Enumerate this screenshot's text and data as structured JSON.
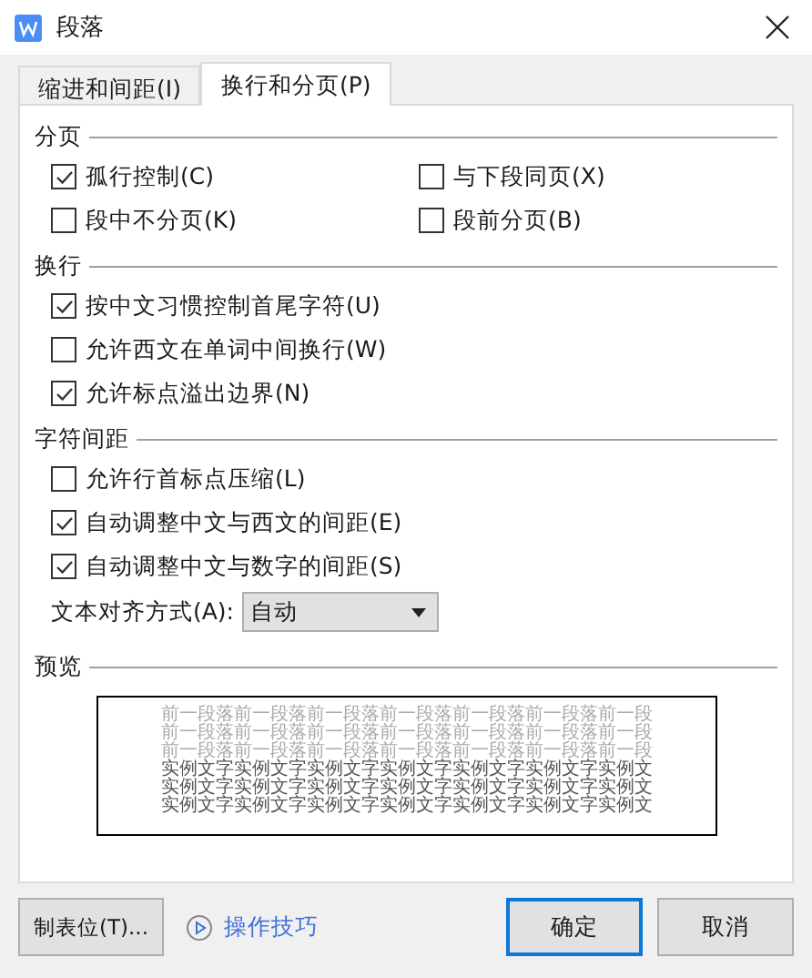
{
  "window": {
    "title": "段落"
  },
  "tabs": [
    {
      "label": "缩进和间距(I)",
      "selected": false
    },
    {
      "label": "换行和分页(P)",
      "selected": true
    }
  ],
  "sections": [
    {
      "title": "分页",
      "kind": "grid",
      "options": [
        {
          "label": "孤行控制(C)",
          "checked": true
        },
        {
          "label": "与下段同页(X)",
          "checked": false
        },
        {
          "label": "段中不分页(K)",
          "checked": false
        },
        {
          "label": "段前分页(B)",
          "checked": false
        }
      ]
    },
    {
      "title": "换行",
      "kind": "list",
      "options": [
        {
          "label": "按中文习惯控制首尾字符(U)",
          "checked": true
        },
        {
          "label": "允许西文在单词中间换行(W)",
          "checked": false
        },
        {
          "label": "允许标点溢出边界(N)",
          "checked": true
        }
      ]
    },
    {
      "title": "字符间距",
      "kind": "list",
      "options": [
        {
          "label": "允许行首标点压缩(L)",
          "checked": false
        },
        {
          "label": "自动调整中文与西文的间距(E)",
          "checked": true
        },
        {
          "label": "自动调整中文与数字的间距(S)",
          "checked": true
        }
      ],
      "select": {
        "label": "文本对齐方式(A):",
        "value": "自动"
      }
    }
  ],
  "preview": {
    "title": "预览",
    "lines": [
      {
        "kind": "previous",
        "text": "前一段落前一段落前一段落前一段落前一段落前一段落前一段"
      },
      {
        "kind": "previous",
        "text": "前一段落前一段落前一段落前一段落前一段落前一段落前一段"
      },
      {
        "kind": "previous",
        "text": "前一段落前一段落前一段落前一段落前一段落前一段落前一段"
      },
      {
        "kind": "sample",
        "text": "实例文字实例文字实例文字实例文字实例文字实例文字实例文"
      },
      {
        "kind": "sample",
        "text": "实例文字实例文字实例文字实例文字实例文字实例文字实例文"
      },
      {
        "kind": "sample",
        "text": "实例文字实例文字实例文字实例文字实例文字实例文字实例文"
      }
    ]
  },
  "footer": {
    "tabs_button": "制表位(T)...",
    "tips_link": "操作技巧",
    "buttons": [
      {
        "label": "确定",
        "default": true
      },
      {
        "label": "取消",
        "default": false
      }
    ]
  }
}
